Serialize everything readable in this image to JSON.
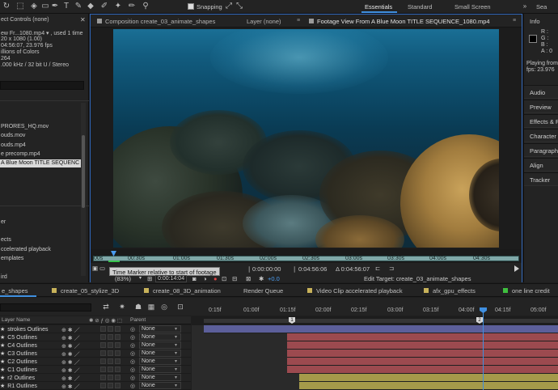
{
  "toolbar": {
    "snapping_label": "Snapping",
    "workspaces": [
      "Essentials",
      "Standard",
      "Small Screen",
      "Sea"
    ]
  },
  "project": {
    "panel_title": "ect Controls (none)",
    "info_lines": [
      "ew Fr...1080.mp4 ▾ , used 1 time",
      "20 x 1080 (1.00)",
      "04:56:07, 23.976 fps",
      "illions of Colors",
      "264",
      ".000 kHz / 32 bit U / Stereo"
    ],
    "items": [
      {
        "label": "PRORES_HQ.mov",
        "selected": false
      },
      {
        "label": "ouds.mov",
        "selected": false
      },
      {
        "label": "ouds.mp4",
        "selected": false
      },
      {
        "label": "e precomp.mp4",
        "selected": false
      },
      {
        "label": "A Blue Moon TITLE SEQUENC",
        "selected": true
      },
      {
        "label": "",
        "selected": false
      },
      {
        "label": "",
        "selected": false
      },
      {
        "label": "er",
        "selected": false
      },
      {
        "label": "",
        "selected": false
      },
      {
        "label": "ects",
        "selected": false
      },
      {
        "label": "ccelerated playback",
        "selected": false
      },
      {
        "label": "emplates",
        "selected": false
      },
      {
        "label": "",
        "selected": false
      },
      {
        "label": "",
        "selected": false
      },
      {
        "label": "ird",
        "selected": false
      }
    ]
  },
  "viewer": {
    "tabs": [
      {
        "label": "Composition create_03_animate_shapes",
        "active": false
      },
      {
        "label": "Layer (none)",
        "active": false
      },
      {
        "label": "Footage View From A Blue Moon TITLE SEQUENCE_1080.mp4",
        "active": true
      }
    ],
    "ruler_labels": [
      "00s",
      "00:30s",
      "01:00s",
      "01:30s",
      "02:00s",
      "02:30s",
      "03:00s",
      "03:30s",
      "04:00s",
      "04:30s"
    ],
    "tooltip": "Time Marker relative to start of footage",
    "zoom": "(83%)",
    "current_time": "0:00:14:04",
    "offset": "+0.0",
    "in_point": "0:00:00:00",
    "out_point": "0:04:56:06",
    "duration": "Δ 0:04:56:07",
    "edit_target": "Edit Target: create_03_animate_shapes"
  },
  "right_panel": {
    "title": "Info",
    "color_values": [
      "R :",
      "G :",
      "B :",
      "A : 0"
    ],
    "playing_from": "Playing from",
    "fps": "fps: 23.976",
    "sections": [
      "Audio",
      "Preview",
      "Effects & Pr",
      "Character",
      "Paragraph",
      "Align",
      "Tracker"
    ]
  },
  "timeline": {
    "tabs": [
      {
        "label": "e_shapes",
        "color": "#d8d8d8",
        "active": true
      },
      {
        "label": "create_05_stylize_3D",
        "color": "#c8b25a",
        "active": false
      },
      {
        "label": "create_08_3D_animation",
        "color": "#c8b25a",
        "active": false
      },
      {
        "label": "Render Queue",
        "color": "",
        "active": false
      },
      {
        "label": "Video Clip accelerated playback",
        "color": "#c8b25a",
        "active": false
      },
      {
        "label": "afx_gpu_effects",
        "color": "#c8b25a",
        "active": false
      },
      {
        "label": "one line credit",
        "color": "#3fbf3f",
        "active": false
      }
    ],
    "column_headers": {
      "layer_name": "Layer Name",
      "parent": "Parent"
    },
    "ruler_labels": [
      "0:15f",
      "01:00f",
      "01:15f",
      "02:00f",
      "02:15f",
      "03:00f",
      "03:15f",
      "04:00f",
      "04:15f",
      "05:00f"
    ],
    "markers": [
      "1",
      "2"
    ],
    "layers": [
      {
        "name": "strokes Outlines",
        "parent": "None",
        "bar_color": "#5c5f9a"
      },
      {
        "name": "C5 Outlines",
        "parent": "None",
        "bar_color": "#9c4a4f"
      },
      {
        "name": "C4 Outlines",
        "parent": "None",
        "bar_color": "#9c4a4f"
      },
      {
        "name": "C3 Outlines",
        "parent": "None",
        "bar_color": "#9c4a4f"
      },
      {
        "name": "C2 Outlines",
        "parent": "None",
        "bar_color": "#9c4a4f"
      },
      {
        "name": "C1 Outlines",
        "parent": "None",
        "bar_color": "#9c4a4f"
      },
      {
        "name": "r2 Outlines",
        "parent": "None",
        "bar_color": "#a59a4a"
      },
      {
        "name": "R1 Outlines",
        "parent": "None",
        "bar_color": "#a59a4a"
      }
    ]
  }
}
